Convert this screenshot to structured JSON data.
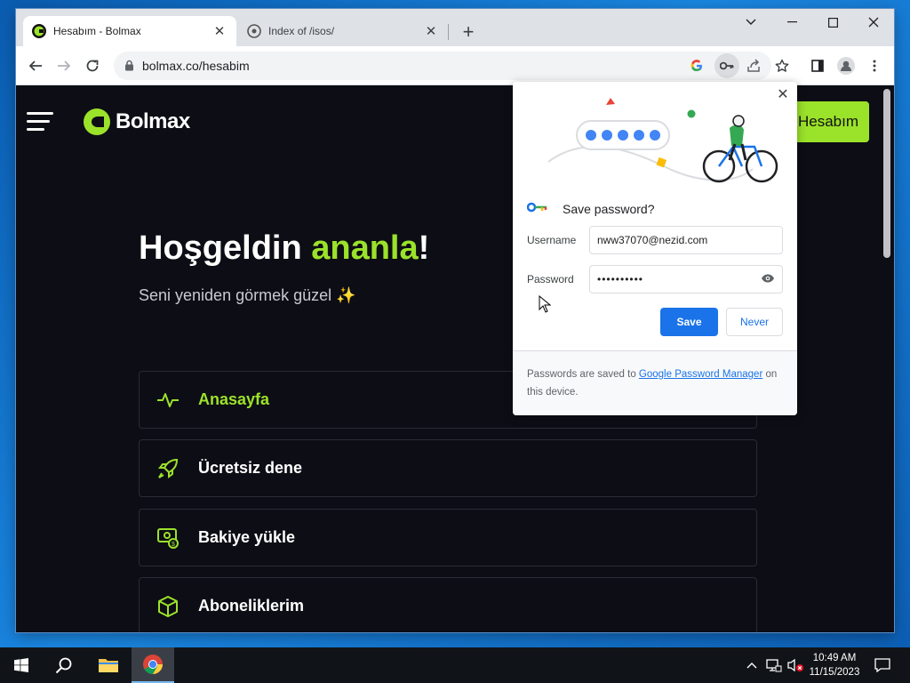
{
  "browser": {
    "tabs": [
      {
        "title": "Hesabım - Bolmax",
        "active": true
      },
      {
        "title": "Index of /isos/",
        "active": false
      }
    ],
    "url": "bolmax.co/hesabim"
  },
  "site": {
    "brand": "Bolmax",
    "account_button": "Hesabım",
    "welcome_prefix": "Hoşgeldin ",
    "welcome_name": "ananla",
    "welcome_suffix": "!",
    "subtitle": "Seni yeniden görmek güzel ✨",
    "menu": [
      {
        "label": "Anasayfa",
        "icon": "activity-icon",
        "active": true
      },
      {
        "label": "Ücretsiz dene",
        "icon": "rocket-icon",
        "active": false
      },
      {
        "label": "Bakiye yükle",
        "icon": "money-icon",
        "active": false
      },
      {
        "label": "Aboneliklerim",
        "icon": "box-icon",
        "active": false
      }
    ],
    "accent_color": "#9be22a"
  },
  "password_dialog": {
    "title": "Save password?",
    "username_label": "Username",
    "username_value": "nww37070@nezid.com",
    "password_label": "Password",
    "password_value": "••••••••••",
    "save_label": "Save",
    "never_label": "Never",
    "footer_prefix": "Passwords are saved to ",
    "footer_link": "Google Password Manager",
    "footer_suffix": " on this device."
  },
  "taskbar": {
    "time": "10:49 AM",
    "date": "11/15/2023"
  }
}
